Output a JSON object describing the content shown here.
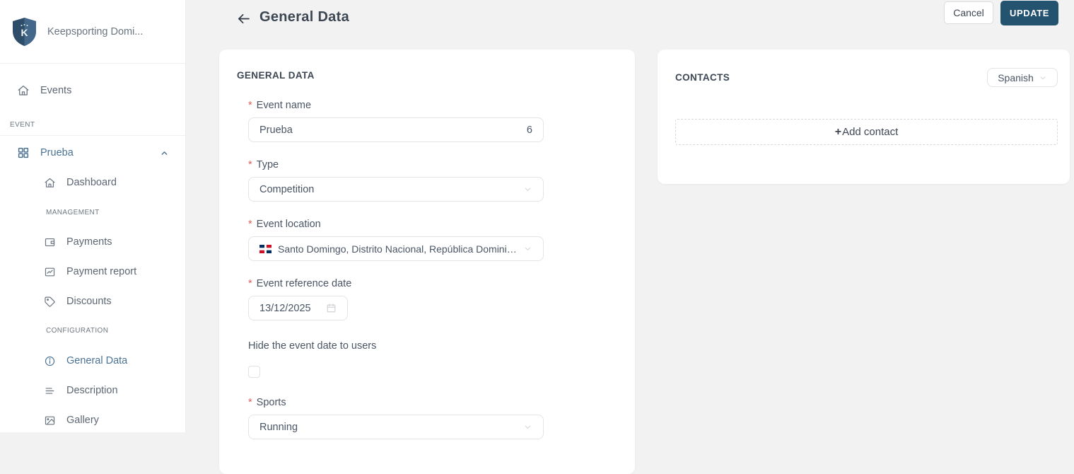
{
  "brand": {
    "name": "Keepsporting Domi...",
    "logo_letter": "K"
  },
  "sidebar": {
    "events_label": "Events",
    "event_section": "EVENT",
    "event_menu_label": "Prueba",
    "dashboard_label": "Dashboard",
    "management_section": "MANAGEMENT",
    "management_items": [
      "Payments",
      "Payment report",
      "Discounts"
    ],
    "configuration_section": "CONFIGURATION",
    "configuration_items": [
      "General Data",
      "Description",
      "Gallery"
    ],
    "active_item": "General Data"
  },
  "header": {
    "title": "General Data",
    "cancel_label": "Cancel",
    "update_label": "UPDATE"
  },
  "general_data": {
    "card_title": "GENERAL DATA",
    "required_marker": "*",
    "event_name": {
      "label": "Event name",
      "value": "Prueba",
      "counter": "6"
    },
    "type": {
      "label": "Type",
      "value": "Competition"
    },
    "event_location": {
      "label": "Event location",
      "value": "Santo Domingo, Distrito Nacional, República Dominica...",
      "flag": "dominican-republic"
    },
    "reference_date": {
      "label": "Event reference date",
      "value": "13/12/2025"
    },
    "hide_date": {
      "label": "Hide the event date to users",
      "checked": false
    },
    "sports": {
      "label": "Sports",
      "value": "Running"
    }
  },
  "contacts": {
    "card_title": "CONTACTS",
    "language": "Spanish",
    "plus_sign": "+",
    "add_contact_label": "Add contact"
  },
  "colors": {
    "brand_primary": "#24536f",
    "sidebar_active": "#4a7294",
    "required_red": "#df5e5e",
    "page_background": "#f2f2f2"
  }
}
